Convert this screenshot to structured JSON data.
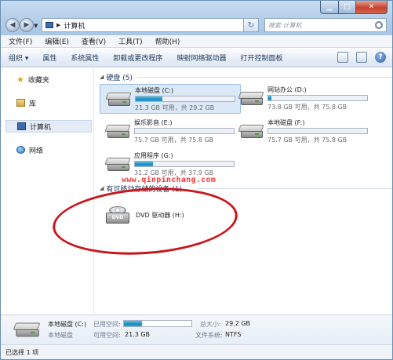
{
  "window": {
    "min_label": "▁",
    "max_label": "□",
    "close_label": "✕"
  },
  "address": {
    "location": "计算机",
    "search_placeholder": "搜索 计算机"
  },
  "menu": [
    "文件(F)",
    "编辑(E)",
    "查看(V)",
    "工具(T)",
    "帮助(H)"
  ],
  "toolbar": [
    "组织 ▾",
    "属性",
    "系统属性",
    "卸载或更改程序",
    "映射网络驱动器",
    "打开控制面板"
  ],
  "nav": {
    "favorites": "收藏夹",
    "libraries": "库",
    "computer": "计算机",
    "network": "网络"
  },
  "groups": {
    "hard_disks": "硬盘 (5)",
    "removable": "有可移动存储的设备 (1)"
  },
  "drives": [
    {
      "name": "本地磁盘 (C:)",
      "info": "21.3 GB 可用，共 29.2 GB",
      "used_fraction": 0.27
    },
    {
      "name": "网站办公 (D:)",
      "info": "73.8 GB 可用，共 75.8 GB",
      "used_fraction": 0.03
    },
    {
      "name": "娱乐影音 (E:)",
      "info": "75.7 GB 可用，共 75.8 GB",
      "used_fraction": 0.0
    },
    {
      "name": "本地磁盘 (F:)",
      "info": "75.7 GB 可用，共 75.8 GB",
      "used_fraction": 0.0
    },
    {
      "name": "应用程序 (G:)",
      "info": "31.2 GB 可用，共 37.9 GB",
      "used_fraction": 0.18
    }
  ],
  "dvd": {
    "name": "DVD 驱动器 (H:)",
    "badge": "DVD"
  },
  "watermark": "www.qinpinchang.com",
  "details": {
    "name": "本地磁盘 (C:)",
    "type": "本地磁盘",
    "used_label": "已用空间:",
    "free_label": "可用空间:",
    "free_value": "21.3 GB",
    "total_label": "总大小:",
    "total_value": "29.2 GB",
    "fs_label": "文件系统:",
    "fs_value": "NTFS",
    "used_fraction": 0.27
  },
  "status": "已选择 1 项"
}
